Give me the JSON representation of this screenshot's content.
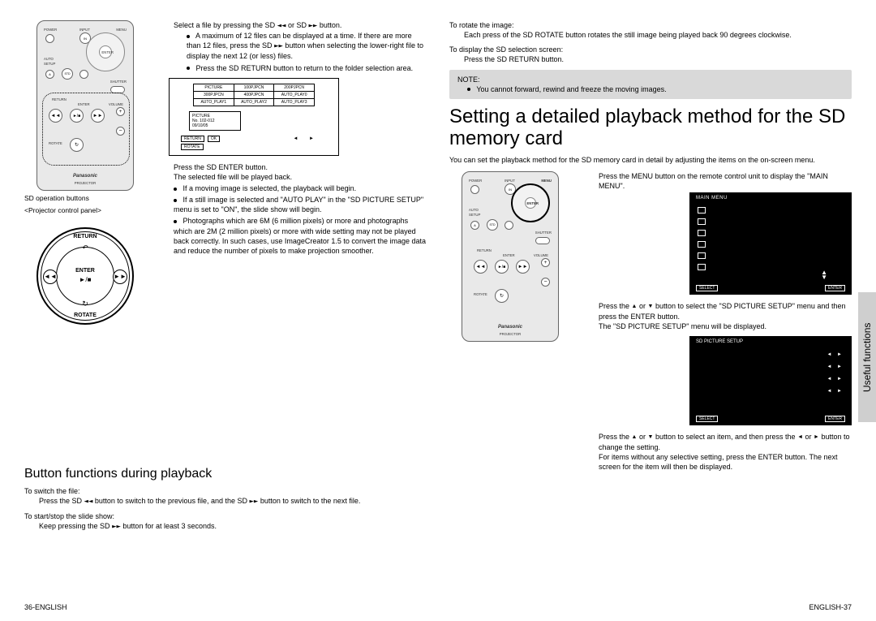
{
  "left": {
    "caption1": "SD operation buttons",
    "caption2": "<Projector control panel>",
    "circle": {
      "return": "RETURN",
      "enter": "ENTER",
      "play": "►/■",
      "rotate": "ROTATE"
    },
    "step_select_a": "Select a file by pressing the SD ",
    "step_select_glyph1": "◄◄",
    "step_select_mid": " or SD ",
    "step_select_glyph2": "►►",
    "step_select_b": " button.",
    "sub1a": "A maximum of 12 files can be displayed at a time. If there are more than 12 files, press the SD ",
    "sub1glyph": "►►",
    "sub1b": " button when selecting the lower-right file to display the next 12 (or less) files.",
    "sub2": "Press the SD RETURN button to return to the folder selection area.",
    "table": {
      "r1": [
        "PICTURE",
        "100PJPCN",
        "200PJPCN"
      ],
      "r2": [
        "300PJPCN",
        "400PJPCN",
        "AUTO_PLAY0"
      ],
      "r3": [
        "AUTO_PLAY1",
        "AUTO_PLAY2",
        "AUTO_PLAY3"
      ]
    },
    "info1": "PICTURE",
    "info2": "No. 102-012",
    "info3": "09/10/05",
    "return_btn": "RETURN",
    "ok_btn": "OK",
    "rotate_btn": "ROTATE",
    "step4": "Press the SD ENTER button.",
    "step4_sub": "The selected file will be played back.",
    "bul1": "If a moving image is selected, the playback will begin.",
    "bul2": "If a still image is selected and \"AUTO PLAY\" in the \"SD PICTURE SETUP\" menu is set to \"ON\", the slide show will begin.",
    "bul3": "Photographs which are 6M (6 million pixels) or more and photographs which are 2M (2 million pixels) or more with wide setting may not be played back correctly. In such cases, use ImageCreator 1.5 to convert the image data and reduce the number of pixels to make projection smoother.",
    "h2": "Button functions during playback",
    "bfp1_t": "To switch the file:",
    "bfp1_a": "Press the SD ",
    "bfp1_g1": "◄◄",
    "bfp1_mid": " button to switch to the previous file, and the SD ",
    "bfp1_g2": "►►",
    "bfp1_b": " button to switch to the next file.",
    "bfp2_t": "To start/stop the slide show:",
    "bfp2_a": "Keep pressing the SD ",
    "bfp2_g": "►►",
    "bfp2_b": " button for at least 3 seconds."
  },
  "right": {
    "rotate_t": "To rotate the image:",
    "rotate_b": "Each press of the SD ROTATE button rotates the still image being played back 90 degrees clockwise.",
    "sel_t": "To display the SD selection screen:",
    "sel_b": "Press the SD RETURN button.",
    "note_label": "NOTE:",
    "note_body": "You cannot forward, rewind and freeze the moving images.",
    "h1": "Setting a detailed playback method for the SD memory card",
    "intro": "You can set the playback method for the SD memory card in detail by adjusting the items on the on-screen menu.",
    "s1": "Press the MENU button on the remote control unit to display the \"MAIN MENU\".",
    "menu_title": "MAIN MENU",
    "menu_b1": "SELECT",
    "menu_b2": "ENTER",
    "s2_a": "Press the ",
    "s2_or": " or ",
    "s2_b": " button to select the \"SD PICTURE SETUP\" menu and then press the ENTER button.",
    "s2_sub": "The \"SD PICTURE SETUP\" menu will be displayed.",
    "spm_title": "SD PICTURE SETUP",
    "s3_a": "Press the ",
    "s3_b": " button to select an item, and then press the ",
    "s3_c": " button to change the setting.",
    "s3_sub": "For items without any selective setting, press the ENTER button. The next screen for the item will then be displayed."
  },
  "sidebar": "Useful functions",
  "footer_left": "36-ENGLISH",
  "footer_right": "ENGLISH-37",
  "remote_labels": {
    "power": "POWER",
    "input": "INPUT",
    "menu": "MENU",
    "enter": "ENTER",
    "auto": "AUTO",
    "setup": "SETUP",
    "shutter": "SHUTTER",
    "return": "RETURN",
    "volume": "VOLUME",
    "rotate": "ROTATE",
    "brand": "Panasonic",
    "proj": "PROJECTOR",
    "in": "IN",
    "a": "A",
    "std": "STD"
  }
}
